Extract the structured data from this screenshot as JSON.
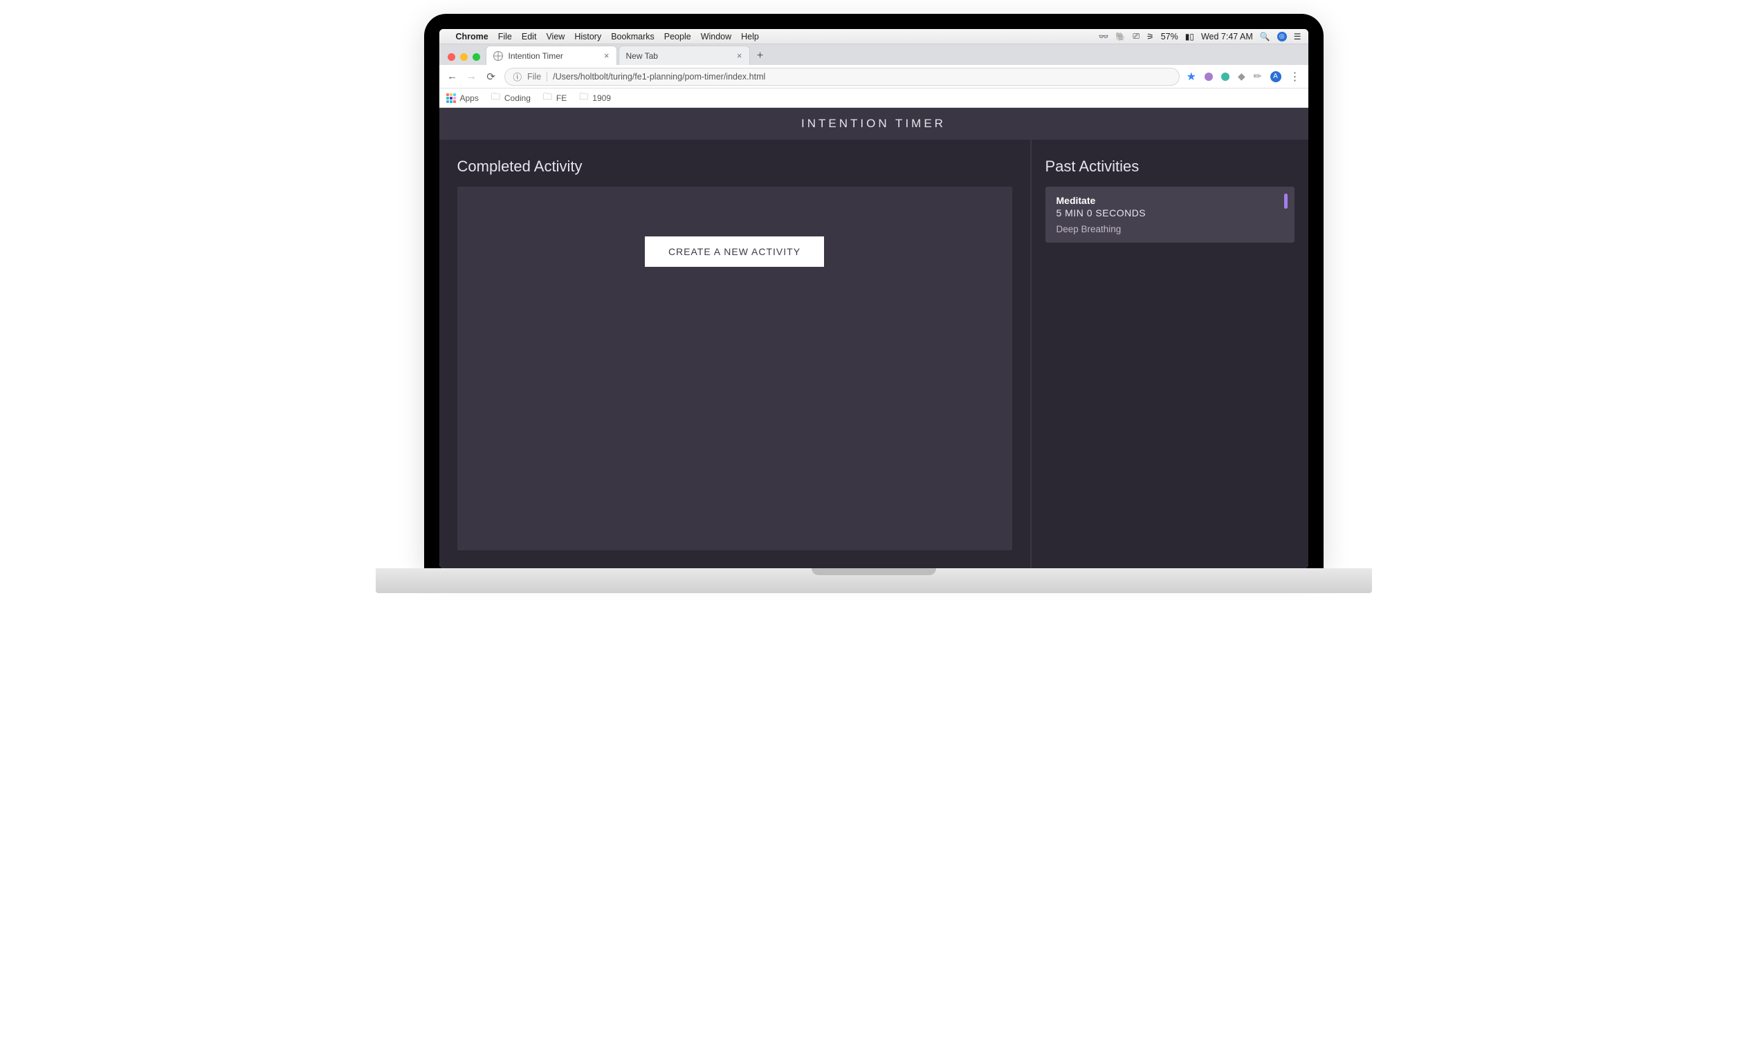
{
  "mac_menu": {
    "app": "Chrome",
    "items": [
      "File",
      "Edit",
      "View",
      "History",
      "Bookmarks",
      "People",
      "Window",
      "Help"
    ],
    "battery": "57%",
    "clock": "Wed 7:47 AM"
  },
  "browser": {
    "tabs": [
      {
        "title": "Intention Timer",
        "active": true
      },
      {
        "title": "New Tab",
        "active": false
      }
    ],
    "address_scheme_label": "File",
    "address_path": "/Users/holtbolt/turing/fe1-planning/pom-timer/index.html",
    "bookmarks": {
      "apps_label": "Apps",
      "items": [
        "Coding",
        "FE",
        "1909"
      ]
    }
  },
  "app": {
    "title": "INTENTION TIMER",
    "left": {
      "heading": "Completed Activity",
      "cta_label": "CREATE A NEW ACTIVITY"
    },
    "right": {
      "heading": "Past Activities",
      "cards": [
        {
          "title": "Meditate",
          "duration": "5 MIN 0 SECONDS",
          "description": "Deep Breathing",
          "accent_color": "#a57cf0"
        }
      ]
    }
  }
}
